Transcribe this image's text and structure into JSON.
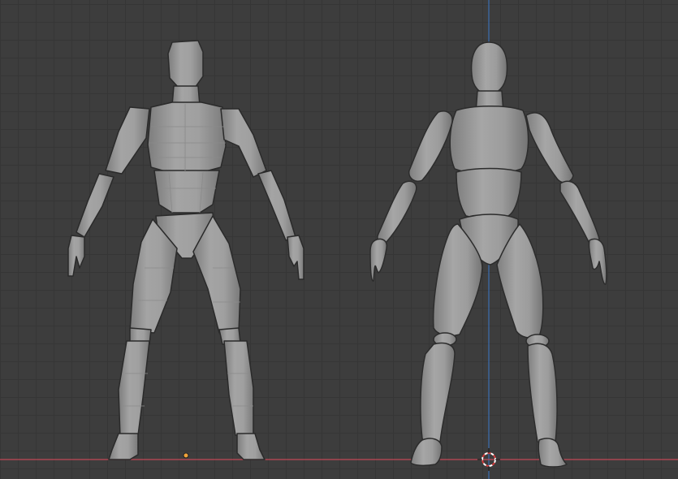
{
  "viewport": {
    "view": "front-orthographic",
    "grid": true,
    "colors": {
      "background": "#3d3d3d",
      "grid_line": "#363636",
      "x_axis": "#c14755",
      "z_axis": "#3b77c9",
      "mesh": "#9a9a9a",
      "mesh_shadow": "#777777",
      "outline": "#2a2a2a",
      "origin_dot": "#f0a33a",
      "cursor_red": "#d23b3b"
    }
  },
  "objects": [
    {
      "kind": "low-poly mannequin",
      "shading": "flat"
    },
    {
      "kind": "smooth mannequin",
      "shading": "smooth"
    }
  ],
  "icons": {
    "cursor": "3d-cursor-icon",
    "origin": "object-origin-icon"
  }
}
